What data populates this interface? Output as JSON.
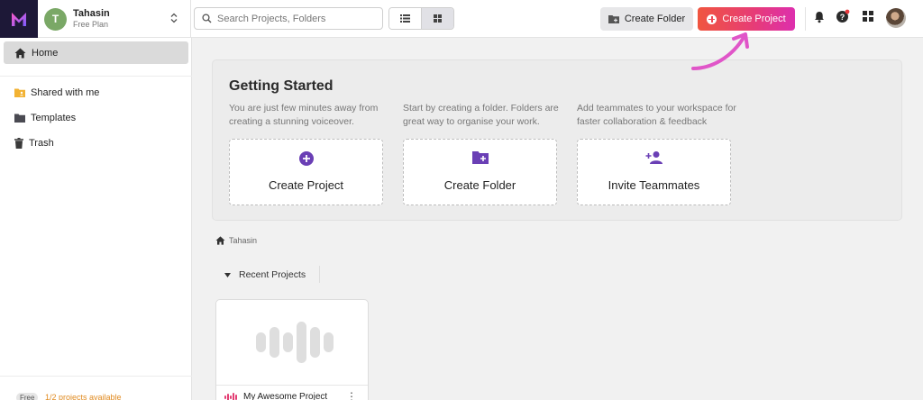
{
  "account": {
    "initial": "T",
    "name": "Tahasin",
    "plan": "Free Plan"
  },
  "search": {
    "placeholder": "Search Projects, Folders"
  },
  "topbar": {
    "create_folder": "Create Folder",
    "create_project": "Create Project"
  },
  "sidebar": {
    "items": [
      {
        "label": "Home",
        "icon": "home-icon"
      },
      {
        "label": "Shared with me",
        "icon": "shared-folder-icon"
      },
      {
        "label": "Templates",
        "icon": "folder-icon"
      },
      {
        "label": "Trash",
        "icon": "trash-icon"
      }
    ],
    "footer": {
      "badge": "Free",
      "projects": "1/2 projects available"
    }
  },
  "getting_started": {
    "title": "Getting Started",
    "cards": [
      {
        "desc": "You are just few minutes away from creating a stunning voiceover.",
        "label": "Create Project",
        "icon": "plus-circle-icon"
      },
      {
        "desc": "Start by creating a folder. Folders are great way to organise your work.",
        "label": "Create Folder",
        "icon": "folder-plus-icon"
      },
      {
        "desc": "Add teammates to your workspace for faster collaboration & feedback",
        "label": "Invite Teammates",
        "icon": "person-add-icon"
      }
    ]
  },
  "breadcrumb": {
    "label": "Tahasin"
  },
  "recent": {
    "label": "Recent Projects"
  },
  "project": {
    "name": "My Awesome Project",
    "menu": "⋮"
  },
  "colors": {
    "accent_purple": "#6a3fb5",
    "cta_start": "#f0553f",
    "cta_end": "#dd2fae",
    "arrow": "#e055c8"
  }
}
